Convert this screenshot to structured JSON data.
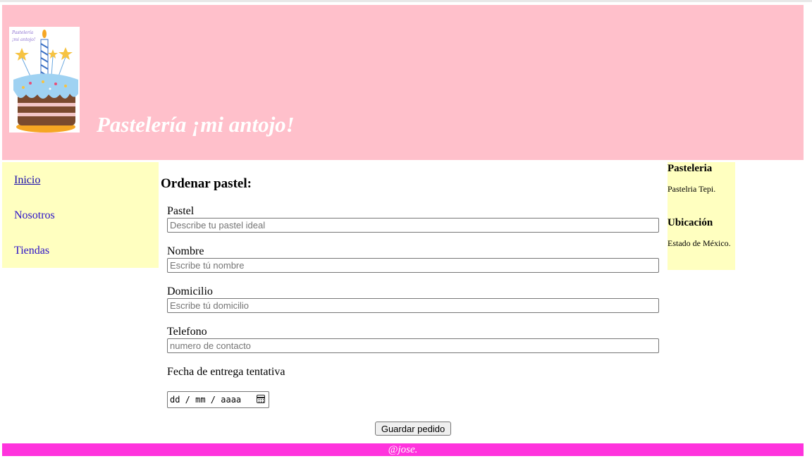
{
  "header": {
    "logo_caption": "Pastelería ¡mi antojo!",
    "title": "Pastelería ¡mi antojo!"
  },
  "nav": {
    "items": [
      {
        "label": "Inicio"
      },
      {
        "label": "Nosotros"
      },
      {
        "label": "Tiendas"
      }
    ]
  },
  "form": {
    "title": "Ordenar pastel:",
    "fields": [
      {
        "label": "Pastel",
        "placeholder": "Describe tu pastel ideal",
        "value": ""
      },
      {
        "label": "Nombre",
        "placeholder": "Escribe tú nombre",
        "value": ""
      },
      {
        "label": "Domicilio",
        "placeholder": "Escribe tú domicilio",
        "value": ""
      },
      {
        "label": "Telefono",
        "placeholder": "numero de contacto",
        "value": ""
      }
    ],
    "date_label": "Fecha de entrega tentativa",
    "date_placeholder": "dd / mm / aaaa",
    "submit_label": "Guardar pedido"
  },
  "aside": {
    "heading1": "Pasteleria",
    "text1": "Pastelria Tepi.",
    "heading2": "Ubicación",
    "text2": "Estado de México."
  },
  "footer": {
    "text": "@jose."
  },
  "colors": {
    "header_bg": "#ffc0cb",
    "sidebar_bg": "#ffffc0",
    "footer_bg": "#ff33dd",
    "link": "#2a10c8"
  }
}
